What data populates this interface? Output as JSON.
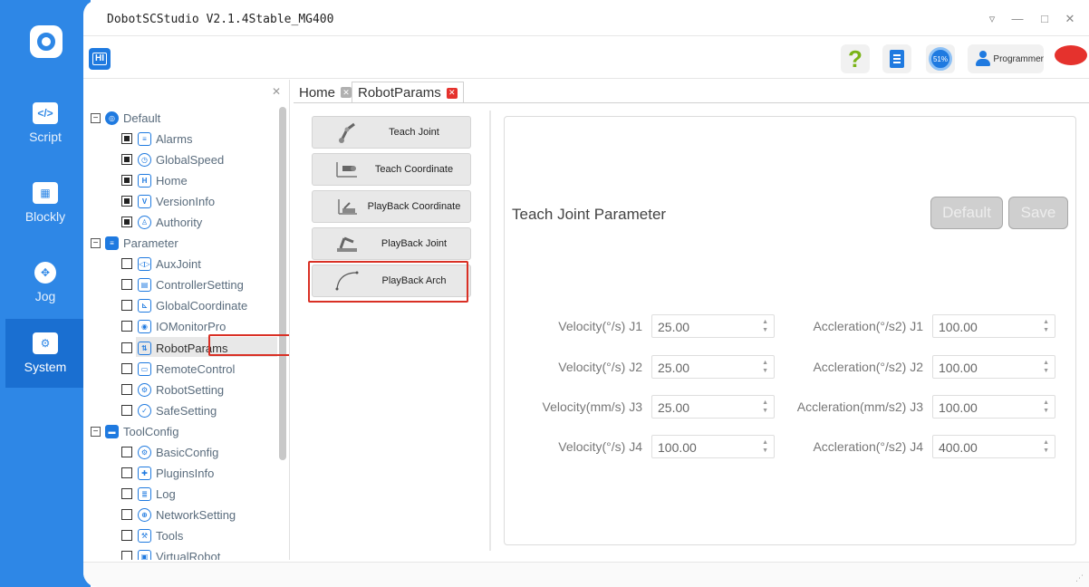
{
  "app": {
    "window_title": "DobotSCStudio V2.1.4Stable_MG400",
    "toolbar_hi": "HI",
    "gauge_label": "51%",
    "user_label": "Programmer"
  },
  "nav": [
    {
      "label": "Script"
    },
    {
      "label": "Blockly"
    },
    {
      "label": "Jog"
    },
    {
      "label": "System"
    }
  ],
  "tree": {
    "default_group": "Default",
    "default_items": [
      "Alarms",
      "GlobalSpeed",
      "Home",
      "VersionInfo",
      "Authority"
    ],
    "parameter_group": "Parameter",
    "parameter_items": [
      "AuxJoint",
      "ControllerSetting",
      "GlobalCoordinate",
      "IOMonitorPro",
      "RobotParams",
      "RemoteControl",
      "RobotSetting",
      "SafeSetting"
    ],
    "toolconfig_group": "ToolConfig",
    "toolconfig_items": [
      "BasicConfig",
      "PluginsInfo",
      "Log",
      "NetworkSetting",
      "Tools",
      "VirtualRobot"
    ]
  },
  "tabs": [
    {
      "label": "Home"
    },
    {
      "label": "RobotParams"
    }
  ],
  "functions": [
    "Teach Joint",
    "Teach Coordinate",
    "PlayBack Coordinate",
    "PlayBack Joint",
    "PlayBack Arch"
  ],
  "params": {
    "title": "Teach Joint Parameter",
    "default_label": "Default",
    "save_label": "Save",
    "rows": [
      {
        "vel_label": "Velocity(°/s) J1",
        "vel_value": "25.00",
        "acc_label": "Accleration(°/s2) J1",
        "acc_value": "100.00"
      },
      {
        "vel_label": "Velocity(°/s) J2",
        "vel_value": "25.00",
        "acc_label": "Accleration(°/s2) J2",
        "acc_value": "100.00"
      },
      {
        "vel_label": "Velocity(mm/s) J3",
        "vel_value": "25.00",
        "acc_label": "Accleration(mm/s2) J3",
        "acc_value": "100.00"
      },
      {
        "vel_label": "Velocity(°/s) J4",
        "vel_value": "100.00",
        "acc_label": "Accleration(°/s2) J4",
        "acc_value": "400.00"
      }
    ]
  },
  "colors": {
    "brand": "#2e87e6",
    "highlight": "#d93025",
    "estop": "#e5322d"
  }
}
